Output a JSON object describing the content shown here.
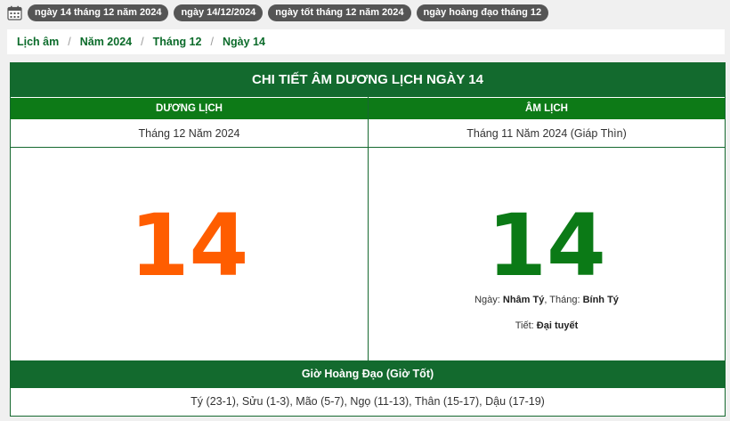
{
  "tags": [
    "ngày 14 tháng 12 năm 2024",
    "ngày 14/12/2024",
    "ngày tốt tháng 12 năm 2024",
    "ngày hoàng đạo tháng 12"
  ],
  "icons": {
    "tag_bar": "calendar-icon"
  },
  "breadcrumb": [
    "Lịch âm",
    "Năm 2024",
    "Tháng 12",
    "Ngày 14"
  ],
  "breadcrumb_separator": "/",
  "card": {
    "title": "CHI TIẾT ÂM DƯƠNG LỊCH NGÀY 14",
    "solar": {
      "header": "DƯƠNG LỊCH",
      "month_year": "Tháng 12 Năm 2024",
      "day": "14"
    },
    "lunar": {
      "header": "ÂM LỊCH",
      "month_year": "Tháng 11 Năm 2024 (Giáp Thìn)",
      "day": "14",
      "day_label": "Ngày:",
      "day_name": "Nhâm Tý",
      "month_label": ", Tháng:",
      "month_name": "Bính Tý",
      "term_label": "Tiết:",
      "term_name": "Đại tuyết"
    },
    "hoang_dao": {
      "header": "Giờ Hoàng Đạo (Giờ Tốt)",
      "hours": "Tý (23-1), Sửu (1-3), Mão (5-7), Ngọ (11-13), Thân (15-17), Dậu (17-19)"
    }
  },
  "colors": {
    "primary_green": "#136a2e",
    "header_green": "#0d7a17",
    "solar_orange": "#ff5d00",
    "lunar_green": "#0b7a16",
    "tag_gray": "#555555"
  }
}
